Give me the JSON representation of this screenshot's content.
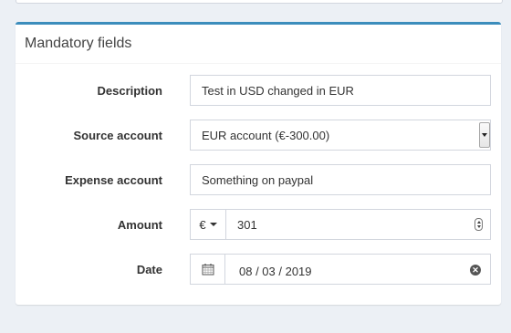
{
  "box": {
    "title": "Mandatory fields"
  },
  "fields": {
    "description": {
      "label": "Description",
      "value": "Test in USD changed in EUR"
    },
    "source_account": {
      "label": "Source account",
      "value": "EUR account (€-300.00)"
    },
    "expense_account": {
      "label": "Expense account",
      "value": "Something on paypal"
    },
    "amount": {
      "label": "Amount",
      "currency": "€",
      "value": "301"
    },
    "date": {
      "label": "Date",
      "value": "08 / 03 / 2019"
    }
  },
  "icons": {
    "calendar": "calendar-icon",
    "clear": "clear-icon",
    "stepper": "number-stepper-icon",
    "dropdown": "chevron-down-icon"
  },
  "colors": {
    "accent": "#3c8dbc",
    "background": "#ecf0f5",
    "border": "#d2d6de"
  }
}
